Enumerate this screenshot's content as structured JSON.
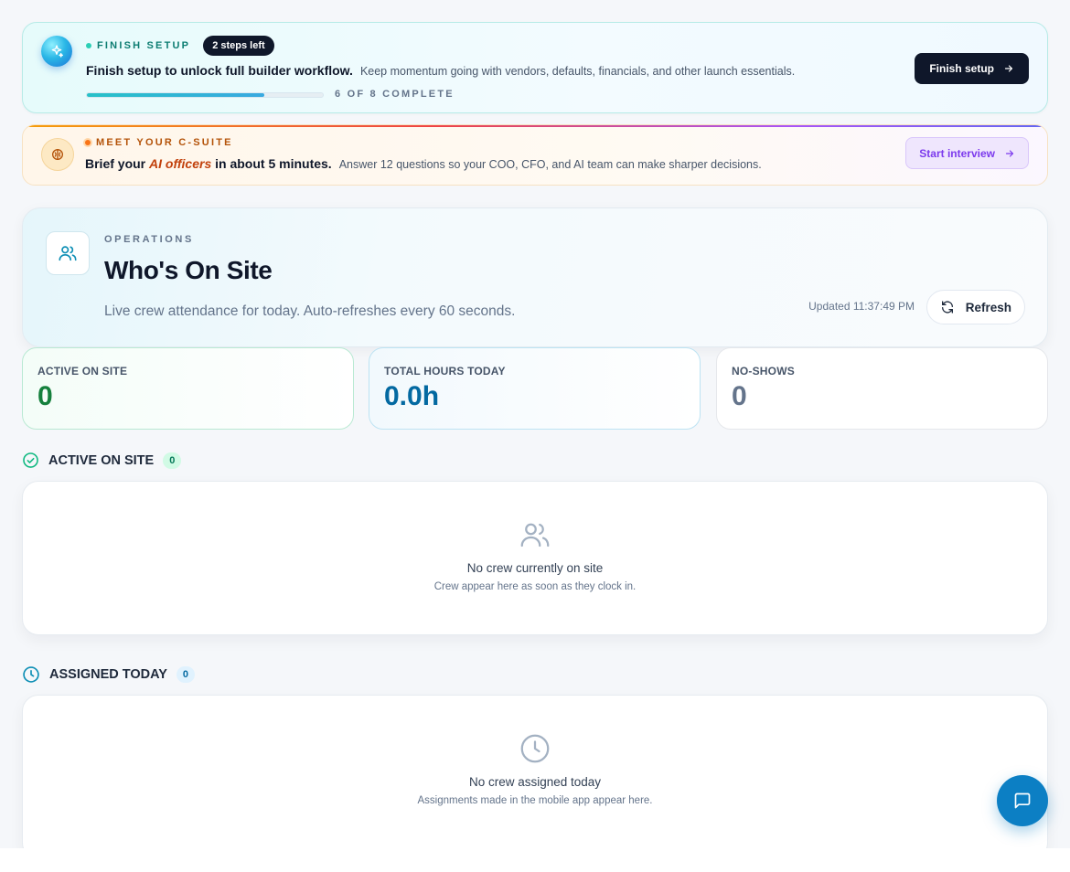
{
  "setup_banner": {
    "eyebrow": "FINISH SETUP",
    "steps_left": "2 steps left",
    "headline": "Finish setup to unlock full builder workflow.",
    "subtext": "Keep momentum going with vendors, defaults, financials, and other launch essentials.",
    "progress_label": "6 OF 8 COMPLETE",
    "progress_fraction": 0.75,
    "button_label": "Finish setup",
    "icon": "sparkle-icon"
  },
  "csuite_banner": {
    "eyebrow": "MEET YOUR C-SUITE",
    "headline_pre": "Brief your ",
    "headline_em": "AI officers",
    "headline_post": " in about 5 minutes.",
    "subtext": "Answer 12 questions so your COO, CFO, and AI team can make sharper decisions.",
    "button_label": "Start interview",
    "icon": "brain-icon"
  },
  "operations": {
    "eyebrow": "OPERATIONS",
    "title": "Who's On Site",
    "subtitle": "Live crew attendance for today. Auto-refreshes every 60 seconds.",
    "updated": "Updated 11:37:49 PM",
    "refresh_label": "Refresh",
    "icon": "users-icon"
  },
  "stats": [
    {
      "label": "ACTIVE ON SITE",
      "value": "0"
    },
    {
      "label": "TOTAL HOURS TODAY",
      "value": "0.0h"
    },
    {
      "label": "NO-SHOWS",
      "value": "0"
    }
  ],
  "active_section": {
    "title": "ACTIVE ON SITE",
    "count": "0",
    "empty_title": "No crew currently on site",
    "empty_sub": "Crew appear here as soon as they clock in.",
    "icon": "check-circle-icon"
  },
  "assigned_section": {
    "title": "ASSIGNED TODAY",
    "count": "0",
    "empty_title": "No crew assigned today",
    "empty_sub": "Assignments made in the mobile app appear here.",
    "icon": "clock-icon"
  },
  "chat": {
    "icon": "chat-icon"
  },
  "colors": {
    "navy": "#0f172a",
    "accent_teal": "#2ccfb5",
    "accent_orange": "#c2410c",
    "accent_purple": "#7c3aed",
    "green": "#15803d",
    "blue": "#0369a1",
    "fab": "#0c7fc4"
  }
}
